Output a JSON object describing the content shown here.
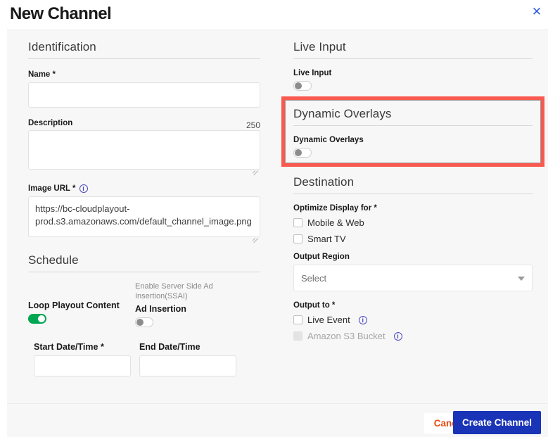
{
  "header": {
    "title": "New Channel",
    "close_icon": "close-icon",
    "close_glyph": "✕"
  },
  "identification": {
    "section_title": "Identification",
    "name": {
      "label": "Name *",
      "value": "",
      "placeholder": ""
    },
    "description": {
      "label": "Description",
      "counter": "250",
      "value": "",
      "placeholder": ""
    },
    "image_url": {
      "label": "Image URL *",
      "info_icon": "info-icon",
      "info_glyph": "i",
      "value": "https://bc-cloudplayout-prod.s3.amazonaws.com/default_channel_image.png",
      "placeholder": ""
    }
  },
  "schedule": {
    "section_title": "Schedule",
    "loop_playout": {
      "label": "Loop Playout Content",
      "state": "on"
    },
    "ad_insertion": {
      "hint": "Enable Server Side Ad Insertion(SSAI)",
      "label": "Ad Insertion",
      "state": "off"
    },
    "start_date": {
      "label": "Start Date/Time *",
      "value": "",
      "placeholder": ""
    },
    "end_date": {
      "label": "End Date/Time",
      "value": "",
      "placeholder": ""
    }
  },
  "live_input": {
    "section_title": "Live Input",
    "toggle": {
      "label": "Live Input",
      "state": "off"
    }
  },
  "dynamic_overlays": {
    "section_title": "Dynamic Overlays",
    "toggle": {
      "label": "Dynamic Overlays",
      "state": "off"
    },
    "highlight_color": "#f9594e"
  },
  "destination": {
    "section_title": "Destination",
    "optimize_display": {
      "label": "Optimize Display for *",
      "options": [
        {
          "label": "Mobile & Web",
          "checked": false,
          "disabled": false
        },
        {
          "label": "Smart TV",
          "checked": false,
          "disabled": false
        }
      ]
    },
    "output_region": {
      "label": "Output Region",
      "selected": "Select",
      "arrow_icon": "chevron-down-icon"
    },
    "output_to": {
      "label": "Output to *",
      "options": [
        {
          "label": "Live Event",
          "checked": false,
          "disabled": false,
          "info_icon": "info-icon",
          "info_glyph": "i"
        },
        {
          "label": "Amazon S3 Bucket",
          "checked": false,
          "disabled": true,
          "info_icon": "info-icon",
          "info_glyph": "i"
        }
      ]
    }
  },
  "footer": {
    "cancel_label": "Cancel",
    "create_label": "Create Channel",
    "cancel_color": "#e8490f",
    "create_bg": "#1a34b8"
  }
}
